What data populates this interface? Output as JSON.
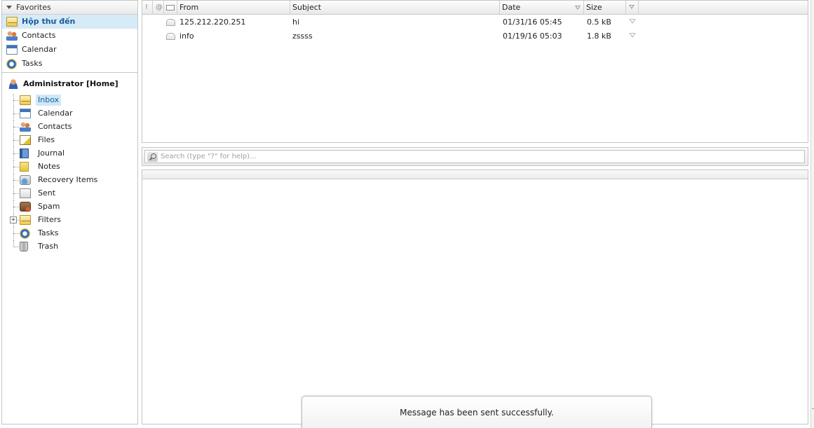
{
  "sidebar": {
    "favorites_header": "Favorites",
    "favorites": [
      {
        "label": "Hộp thư đến",
        "icon": "inbox-icon",
        "selected": true
      },
      {
        "label": "Contacts",
        "icon": "contacts-icon"
      },
      {
        "label": "Calendar",
        "icon": "calendar-icon"
      },
      {
        "label": "Tasks",
        "icon": "tasks-icon"
      }
    ],
    "account": {
      "label": "Administrator [Home]",
      "icon": "user-icon"
    },
    "folders": [
      {
        "label": "Inbox",
        "icon": "inbox-icon",
        "selected": true
      },
      {
        "label": "Calendar",
        "icon": "calendar-icon"
      },
      {
        "label": "Contacts",
        "icon": "contacts-icon"
      },
      {
        "label": "Files",
        "icon": "files-icon"
      },
      {
        "label": "Journal",
        "icon": "journal-icon"
      },
      {
        "label": "Notes",
        "icon": "notes-icon"
      },
      {
        "label": "Recovery Items",
        "icon": "recovery-icon"
      },
      {
        "label": "Sent",
        "icon": "sent-icon"
      },
      {
        "label": "Spam",
        "icon": "spam-icon"
      },
      {
        "label": "Filters",
        "icon": "filters-icon",
        "expander": "+"
      },
      {
        "label": "Tasks",
        "icon": "tasks-icon"
      },
      {
        "label": "Trash",
        "icon": "trash-icon"
      }
    ]
  },
  "message_list": {
    "columns": {
      "priority": "!",
      "attachment": "@",
      "from": "From",
      "subject": "Subject",
      "date": "Date",
      "size": "Size"
    },
    "rows": [
      {
        "from": "125.212.220.251",
        "subject": "hi",
        "date": "01/31/16 05:45",
        "size": "0.5 kB"
      },
      {
        "from": "info",
        "subject": "zssss",
        "date": "01/19/16 05:03",
        "size": "1.8 kB"
      }
    ]
  },
  "search": {
    "placeholder": "Search (type \"?\" for help)..."
  },
  "toast": {
    "message": "Message has been sent successfully."
  },
  "colors": {
    "selection": "#d6ebf7",
    "selected_text": "#1a5c9a",
    "border": "#c5c5c5"
  }
}
